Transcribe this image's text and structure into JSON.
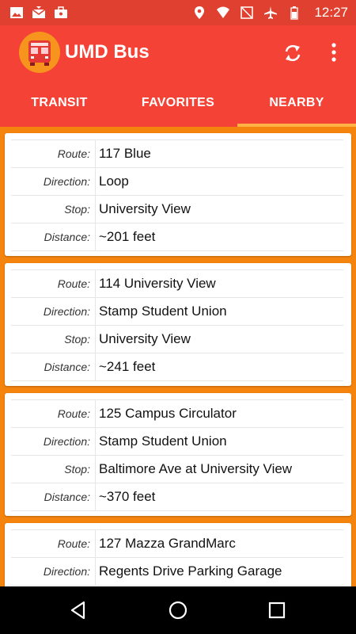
{
  "status_bar": {
    "time": "12:27",
    "left_icons": [
      "image-icon",
      "mail-icon",
      "briefcase-icon"
    ],
    "right_icons": [
      "location-icon",
      "wifi-icon",
      "no-signal-icon",
      "airplane-icon",
      "battery-icon"
    ]
  },
  "app_bar": {
    "title": "UMD Bus",
    "refresh_icon": "refresh-icon",
    "menu_icon": "more-vert-icon"
  },
  "tabs": [
    {
      "label": "TRANSIT",
      "selected": false
    },
    {
      "label": "FAVORITES",
      "selected": false
    },
    {
      "label": "NEARBY",
      "selected": true
    }
  ],
  "field_labels": {
    "route": "Route:",
    "direction": "Direction:",
    "stop": "Stop:",
    "distance": "Distance:"
  },
  "cards": [
    {
      "route": "117 Blue",
      "direction": "Loop",
      "stop": "University View",
      "distance": "~201 feet"
    },
    {
      "route": "114 University View",
      "direction": "Stamp Student Union",
      "stop": "University View",
      "distance": "~241 feet"
    },
    {
      "route": "125 Campus Circulator",
      "direction": "Stamp Student Union",
      "stop": "Baltimore Ave at University View",
      "distance": "~370 feet"
    },
    {
      "route": "127 Mazza GrandMarc",
      "direction": "Regents Drive Parking Garage"
    }
  ],
  "colors": {
    "status_bar": "#e0402f",
    "app_bar": "#f44336",
    "background": "#f5840f",
    "card": "#ffffff"
  }
}
